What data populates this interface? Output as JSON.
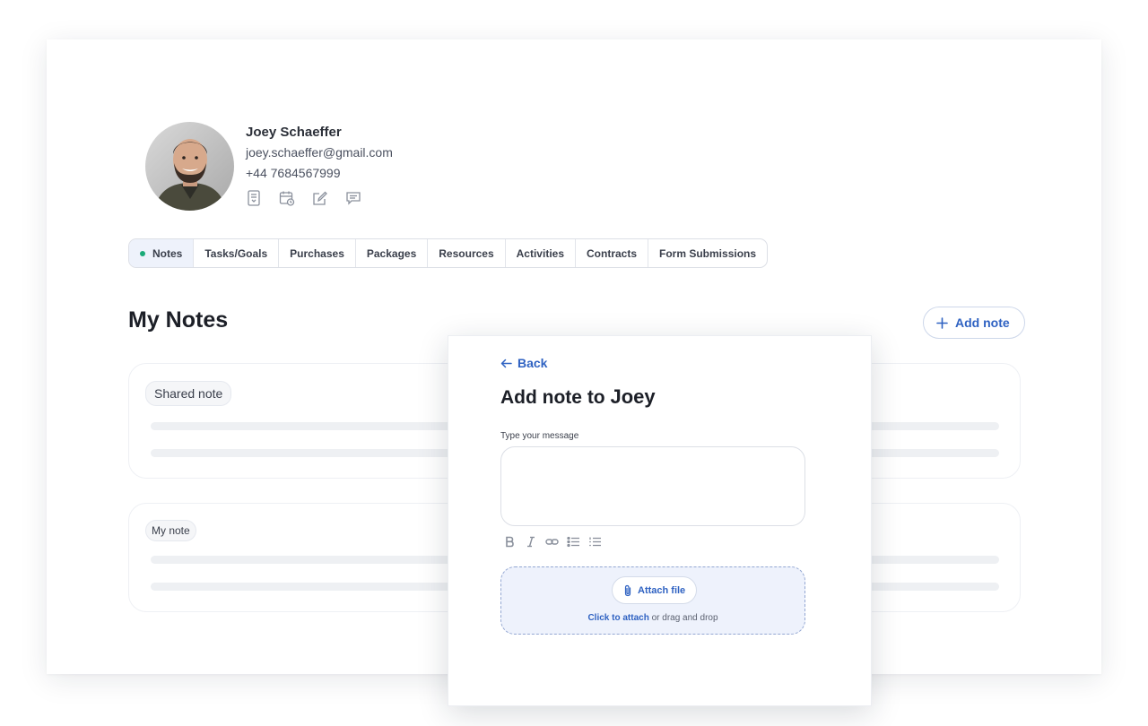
{
  "profile": {
    "name": "Joey Schaeffer",
    "email": "joey.schaeffer@gmail.com",
    "phone": "+44 7684567999",
    "actions": [
      "invoice-icon",
      "calendar-icon",
      "edit-icon",
      "chat-icon"
    ]
  },
  "tabs": [
    {
      "label": "Notes",
      "active": true
    },
    {
      "label": "Tasks/Goals"
    },
    {
      "label": "Purchases"
    },
    {
      "label": "Packages"
    },
    {
      "label": "Resources"
    },
    {
      "label": "Activities"
    },
    {
      "label": "Contracts"
    },
    {
      "label": "Form Submissions"
    }
  ],
  "section": {
    "title": "My Notes",
    "add_label": "Add note"
  },
  "notes": [
    {
      "label": "Shared note"
    },
    {
      "label": "My note"
    }
  ],
  "modal": {
    "back_label": "Back",
    "title_prefix": "Add note to",
    "title_name": "Joey",
    "field_label": "Type your message",
    "message_value": "",
    "toolbar": [
      "bold-icon",
      "italic-icon",
      "link-icon",
      "bullet-list-icon",
      "numbered-list-icon"
    ],
    "attach_label": "Attach file",
    "drop_link": "Click to attach",
    "drop_text": " or drag and drop"
  },
  "colors": {
    "accent": "#2f62c2",
    "active_dot": "#1aaa78",
    "active_tab_bg": "#eef2fb",
    "dropzone_bg": "#eef2fc"
  }
}
